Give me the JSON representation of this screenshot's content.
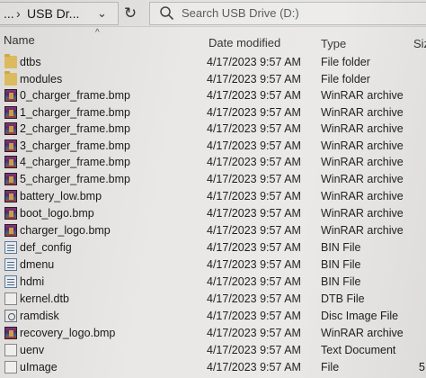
{
  "address_bar": {
    "overflow": "...",
    "separator": "›",
    "path": "USB Dr...",
    "dropdown_glyph": "⌄"
  },
  "refresh_glyph": "↻",
  "search": {
    "placeholder": "Search USB Drive (D:)"
  },
  "columns": {
    "name": "Name",
    "sort_glyph": "^",
    "date_modified": "Date modified",
    "type": "Type",
    "size": "Size"
  },
  "files": [
    {
      "name": "dtbs",
      "date": "4/17/2023 9:57 AM",
      "type": "File folder",
      "icon": "folder-icon",
      "size": ""
    },
    {
      "name": "modules",
      "date": "4/17/2023 9:57 AM",
      "type": "File folder",
      "icon": "folder-icon",
      "size": ""
    },
    {
      "name": "0_charger_frame.bmp",
      "date": "4/17/2023 9:57 AM",
      "type": "WinRAR archive",
      "icon": "winrar-archive-icon",
      "size": ""
    },
    {
      "name": "1_charger_frame.bmp",
      "date": "4/17/2023 9:57 AM",
      "type": "WinRAR archive",
      "icon": "winrar-archive-icon",
      "size": ""
    },
    {
      "name": "2_charger_frame.bmp",
      "date": "4/17/2023 9:57 AM",
      "type": "WinRAR archive",
      "icon": "winrar-archive-icon",
      "size": ""
    },
    {
      "name": "3_charger_frame.bmp",
      "date": "4/17/2023 9:57 AM",
      "type": "WinRAR archive",
      "icon": "winrar-archive-icon",
      "size": ""
    },
    {
      "name": "4_charger_frame.bmp",
      "date": "4/17/2023 9:57 AM",
      "type": "WinRAR archive",
      "icon": "winrar-archive-icon",
      "size": ""
    },
    {
      "name": "5_charger_frame.bmp",
      "date": "4/17/2023 9:57 AM",
      "type": "WinRAR archive",
      "icon": "winrar-archive-icon",
      "size": ""
    },
    {
      "name": "battery_low.bmp",
      "date": "4/17/2023 9:57 AM",
      "type": "WinRAR archive",
      "icon": "winrar-archive-icon",
      "size": ""
    },
    {
      "name": "boot_logo.bmp",
      "date": "4/17/2023 9:57 AM",
      "type": "WinRAR archive",
      "icon": "winrar-archive-icon",
      "size": ""
    },
    {
      "name": "charger_logo.bmp",
      "date": "4/17/2023 9:57 AM",
      "type": "WinRAR archive",
      "icon": "winrar-archive-icon",
      "size": ""
    },
    {
      "name": "def_config",
      "date": "4/17/2023 9:57 AM",
      "type": "BIN File",
      "icon": "bin-file-icon",
      "size": ""
    },
    {
      "name": "dmenu",
      "date": "4/17/2023 9:57 AM",
      "type": "BIN File",
      "icon": "bin-file-icon",
      "size": ""
    },
    {
      "name": "hdmi",
      "date": "4/17/2023 9:57 AM",
      "type": "BIN File",
      "icon": "bin-file-icon",
      "size": ""
    },
    {
      "name": "kernel.dtb",
      "date": "4/17/2023 9:57 AM",
      "type": "DTB File",
      "icon": "file-icon",
      "size": ""
    },
    {
      "name": "ramdisk",
      "date": "4/17/2023 9:57 AM",
      "type": "Disc Image File",
      "icon": "disc-image-icon",
      "size": ""
    },
    {
      "name": "recovery_logo.bmp",
      "date": "4/17/2023 9:57 AM",
      "type": "WinRAR archive",
      "icon": "winrar-archive-icon",
      "size": ""
    },
    {
      "name": "uenv",
      "date": "4/17/2023 9:57 AM",
      "type": "Text Document",
      "icon": "text-document-icon",
      "size": ""
    },
    {
      "name": "uImage",
      "date": "4/17/2023 9:57 AM",
      "type": "File",
      "icon": "file-icon",
      "size": "5"
    }
  ]
}
